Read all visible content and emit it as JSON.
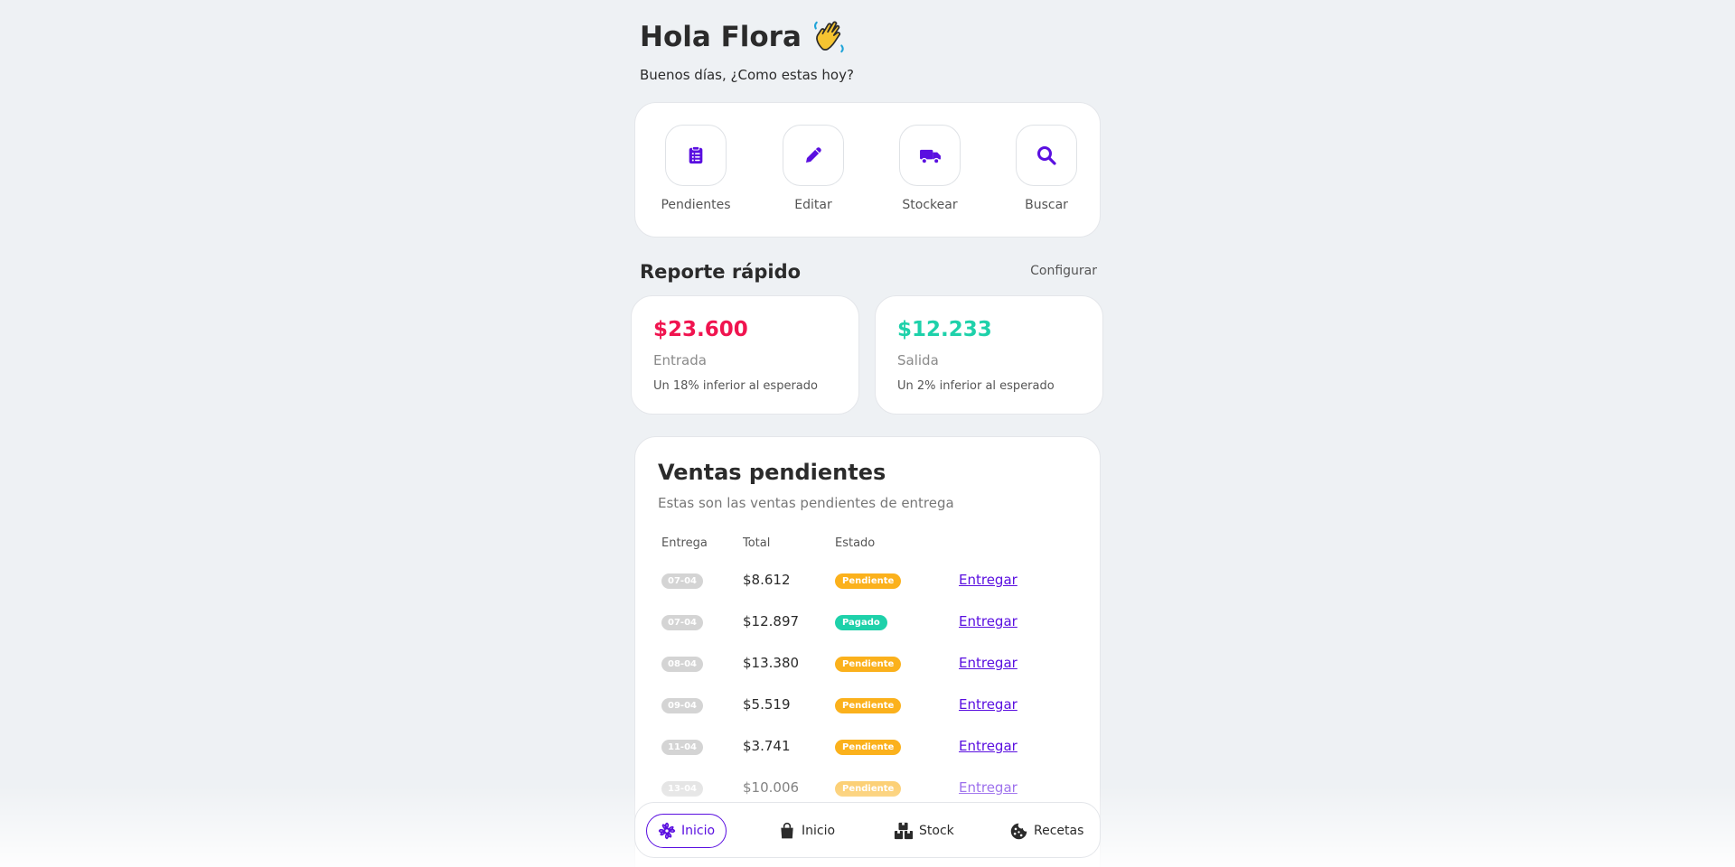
{
  "header": {
    "greeting": "Hola Flora",
    "subtitle": "Buenos días, ¿Como estas hoy?"
  },
  "actions": [
    {
      "label": "Pendientes",
      "icon": "clipboard-list-icon"
    },
    {
      "label": "Editar",
      "icon": "pencil-icon"
    },
    {
      "label": "Stockear",
      "icon": "truck-icon"
    },
    {
      "label": "Buscar",
      "icon": "search-icon"
    }
  ],
  "report": {
    "title": "Reporte rápido",
    "configure_label": "Configurar",
    "cards": [
      {
        "amount": "$23.600",
        "label": "Entrada",
        "note": "Un 18% inferior al esperado",
        "color": "#f0144f"
      },
      {
        "amount": "$12.233",
        "label": "Salida",
        "note": "Un 2% inferior al esperado",
        "color": "#1ed1aa"
      }
    ]
  },
  "sales": {
    "title": "Ventas pendientes",
    "subtitle": "Estas son las ventas pendientes de entrega",
    "columns": {
      "delivery": "Entrega",
      "total": "Total",
      "status": "Estado"
    },
    "rows": [
      {
        "date": "07-04",
        "total": "$8.612",
        "status": "Pendiente",
        "action": "Entregar"
      },
      {
        "date": "07-04",
        "total": "$12.897",
        "status": "Pagado",
        "action": "Entregar"
      },
      {
        "date": "08-04",
        "total": "$13.380",
        "status": "Pendiente",
        "action": "Entregar"
      },
      {
        "date": "09-04",
        "total": "$5.519",
        "status": "Pendiente",
        "action": "Entregar"
      },
      {
        "date": "11-04",
        "total": "$3.741",
        "status": "Pendiente",
        "action": "Entregar"
      },
      {
        "date": "13-04",
        "total": "$10.006",
        "status": "Pendiente",
        "action": "Entregar"
      }
    ]
  },
  "status_colors": {
    "Pendiente": "#fbb11c",
    "Pagado": "#1ed1aa"
  },
  "accent_color": "#5a0fe0",
  "bottom_nav": [
    {
      "label": "Inicio",
      "icon": "flower-icon",
      "active": true
    },
    {
      "label": "Inicio",
      "icon": "shopping-bag-icon",
      "active": false
    },
    {
      "label": "Stock",
      "icon": "boxes-icon",
      "active": false
    },
    {
      "label": "Recetas",
      "icon": "cookie-icon",
      "active": false
    }
  ]
}
